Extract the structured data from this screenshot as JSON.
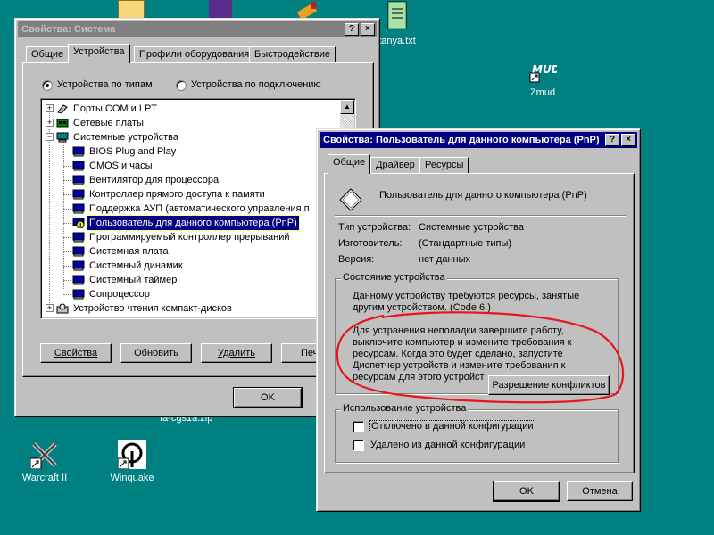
{
  "desktop": {
    "icons": [
      {
        "label": "tanya.txt",
        "icon": "notepad-file-icon"
      },
      {
        "label": "Zmud",
        "icon": "zmud-app-icon"
      },
      {
        "label": "Warcraft II",
        "icon": "warcraft-icon"
      },
      {
        "label": "Winquake",
        "icon": "quake-icon"
      },
      {
        "label": "fa-cgs1a.zip",
        "icon": "zip-file-icon"
      }
    ]
  },
  "system_window": {
    "title": "Свойства: Система",
    "help_btn": "?",
    "close_btn": "×",
    "tabs": [
      "Общие",
      "Устройства",
      "Профили оборудования",
      "Быстродействие"
    ],
    "selected_tab": 1,
    "radio_by_type": "Устройства по типам",
    "radio_by_connection": "Устройства по подключению",
    "tree": [
      {
        "label": "Порты COM и LPT",
        "level": 0,
        "expander": "+",
        "icon": "port-icon"
      },
      {
        "label": "Сетевые платы",
        "level": 0,
        "expander": "+",
        "icon": "network-card-icon"
      },
      {
        "label": "Системные устройства",
        "level": 0,
        "expander": "−",
        "icon": "computer-icon"
      },
      {
        "label": "BIOS Plug and Play",
        "level": 1,
        "icon": "system-device-icon"
      },
      {
        "label": "CMOS и часы",
        "level": 1,
        "icon": "system-device-icon"
      },
      {
        "label": "Вентилятор для процессора",
        "level": 1,
        "icon": "system-device-icon"
      },
      {
        "label": "Контроллер прямого доступа к памяти",
        "level": 1,
        "icon": "system-device-icon"
      },
      {
        "label": "Поддержка АУП (автоматического управления п",
        "level": 1,
        "icon": "system-device-icon"
      },
      {
        "label": "Пользователь для данного компьютера (PnP)",
        "level": 1,
        "icon": "warning-device-icon",
        "selected": true
      },
      {
        "label": "Программируемый контроллер прерываний",
        "level": 1,
        "icon": "system-device-icon"
      },
      {
        "label": "Системная плата",
        "level": 1,
        "icon": "system-device-icon"
      },
      {
        "label": "Системный динамик",
        "level": 1,
        "icon": "system-device-icon"
      },
      {
        "label": "Системный таймер",
        "level": 1,
        "icon": "system-device-icon"
      },
      {
        "label": "Сопроцессор",
        "level": 1,
        "icon": "system-device-icon"
      },
      {
        "label": "Устройство чтения компакт-дисков",
        "level": 0,
        "expander": "+",
        "icon": "cdrom-icon"
      }
    ],
    "buttons": {
      "properties": "Свойства",
      "refresh": "Обновить",
      "remove": "Удалить",
      "print": "Печать"
    },
    "ok": "OK"
  },
  "device_window": {
    "title": "Свойства: Пользователь для данного компьютера (PnP)",
    "help_btn": "?",
    "close_btn": "×",
    "tabs": [
      "Общие",
      "Драйвер",
      "Ресурсы"
    ],
    "selected_tab": 0,
    "device_name": "Пользователь для данного компьютера (PnP)",
    "device_type_label": "Тип устройства:",
    "device_type_value": "Системные устройства",
    "manufacturer_label": "Изготовитель:",
    "manufacturer_value": "(Стандартные типы)",
    "version_label": "Версия:",
    "version_value": "нет данных",
    "status_group_title": "Состояние устройства",
    "status_line1": "Данному устройству требуются ресурсы, занятые",
    "status_line2": "другим устройством.  (Code 6.)",
    "status_help1": "Для устранения неполадки завершите работу,",
    "status_help2": "выключите компьютер и измените требования к",
    "status_help3": "ресурсам. Когда это будет сделано, запустите",
    "status_help4": "Диспетчер устройств и измените требования к",
    "status_help5": "ресурсам для этого устройст",
    "resolve_button": "Разрешение конфликтов",
    "usage_group_title": "Использование устройства",
    "disabled_label": "Отключено в данной конфигурации",
    "removed_label": "Удалено из данной конфигурации",
    "ok": "OK",
    "cancel": "Отмена",
    "highlight_color": "#e8141e"
  }
}
